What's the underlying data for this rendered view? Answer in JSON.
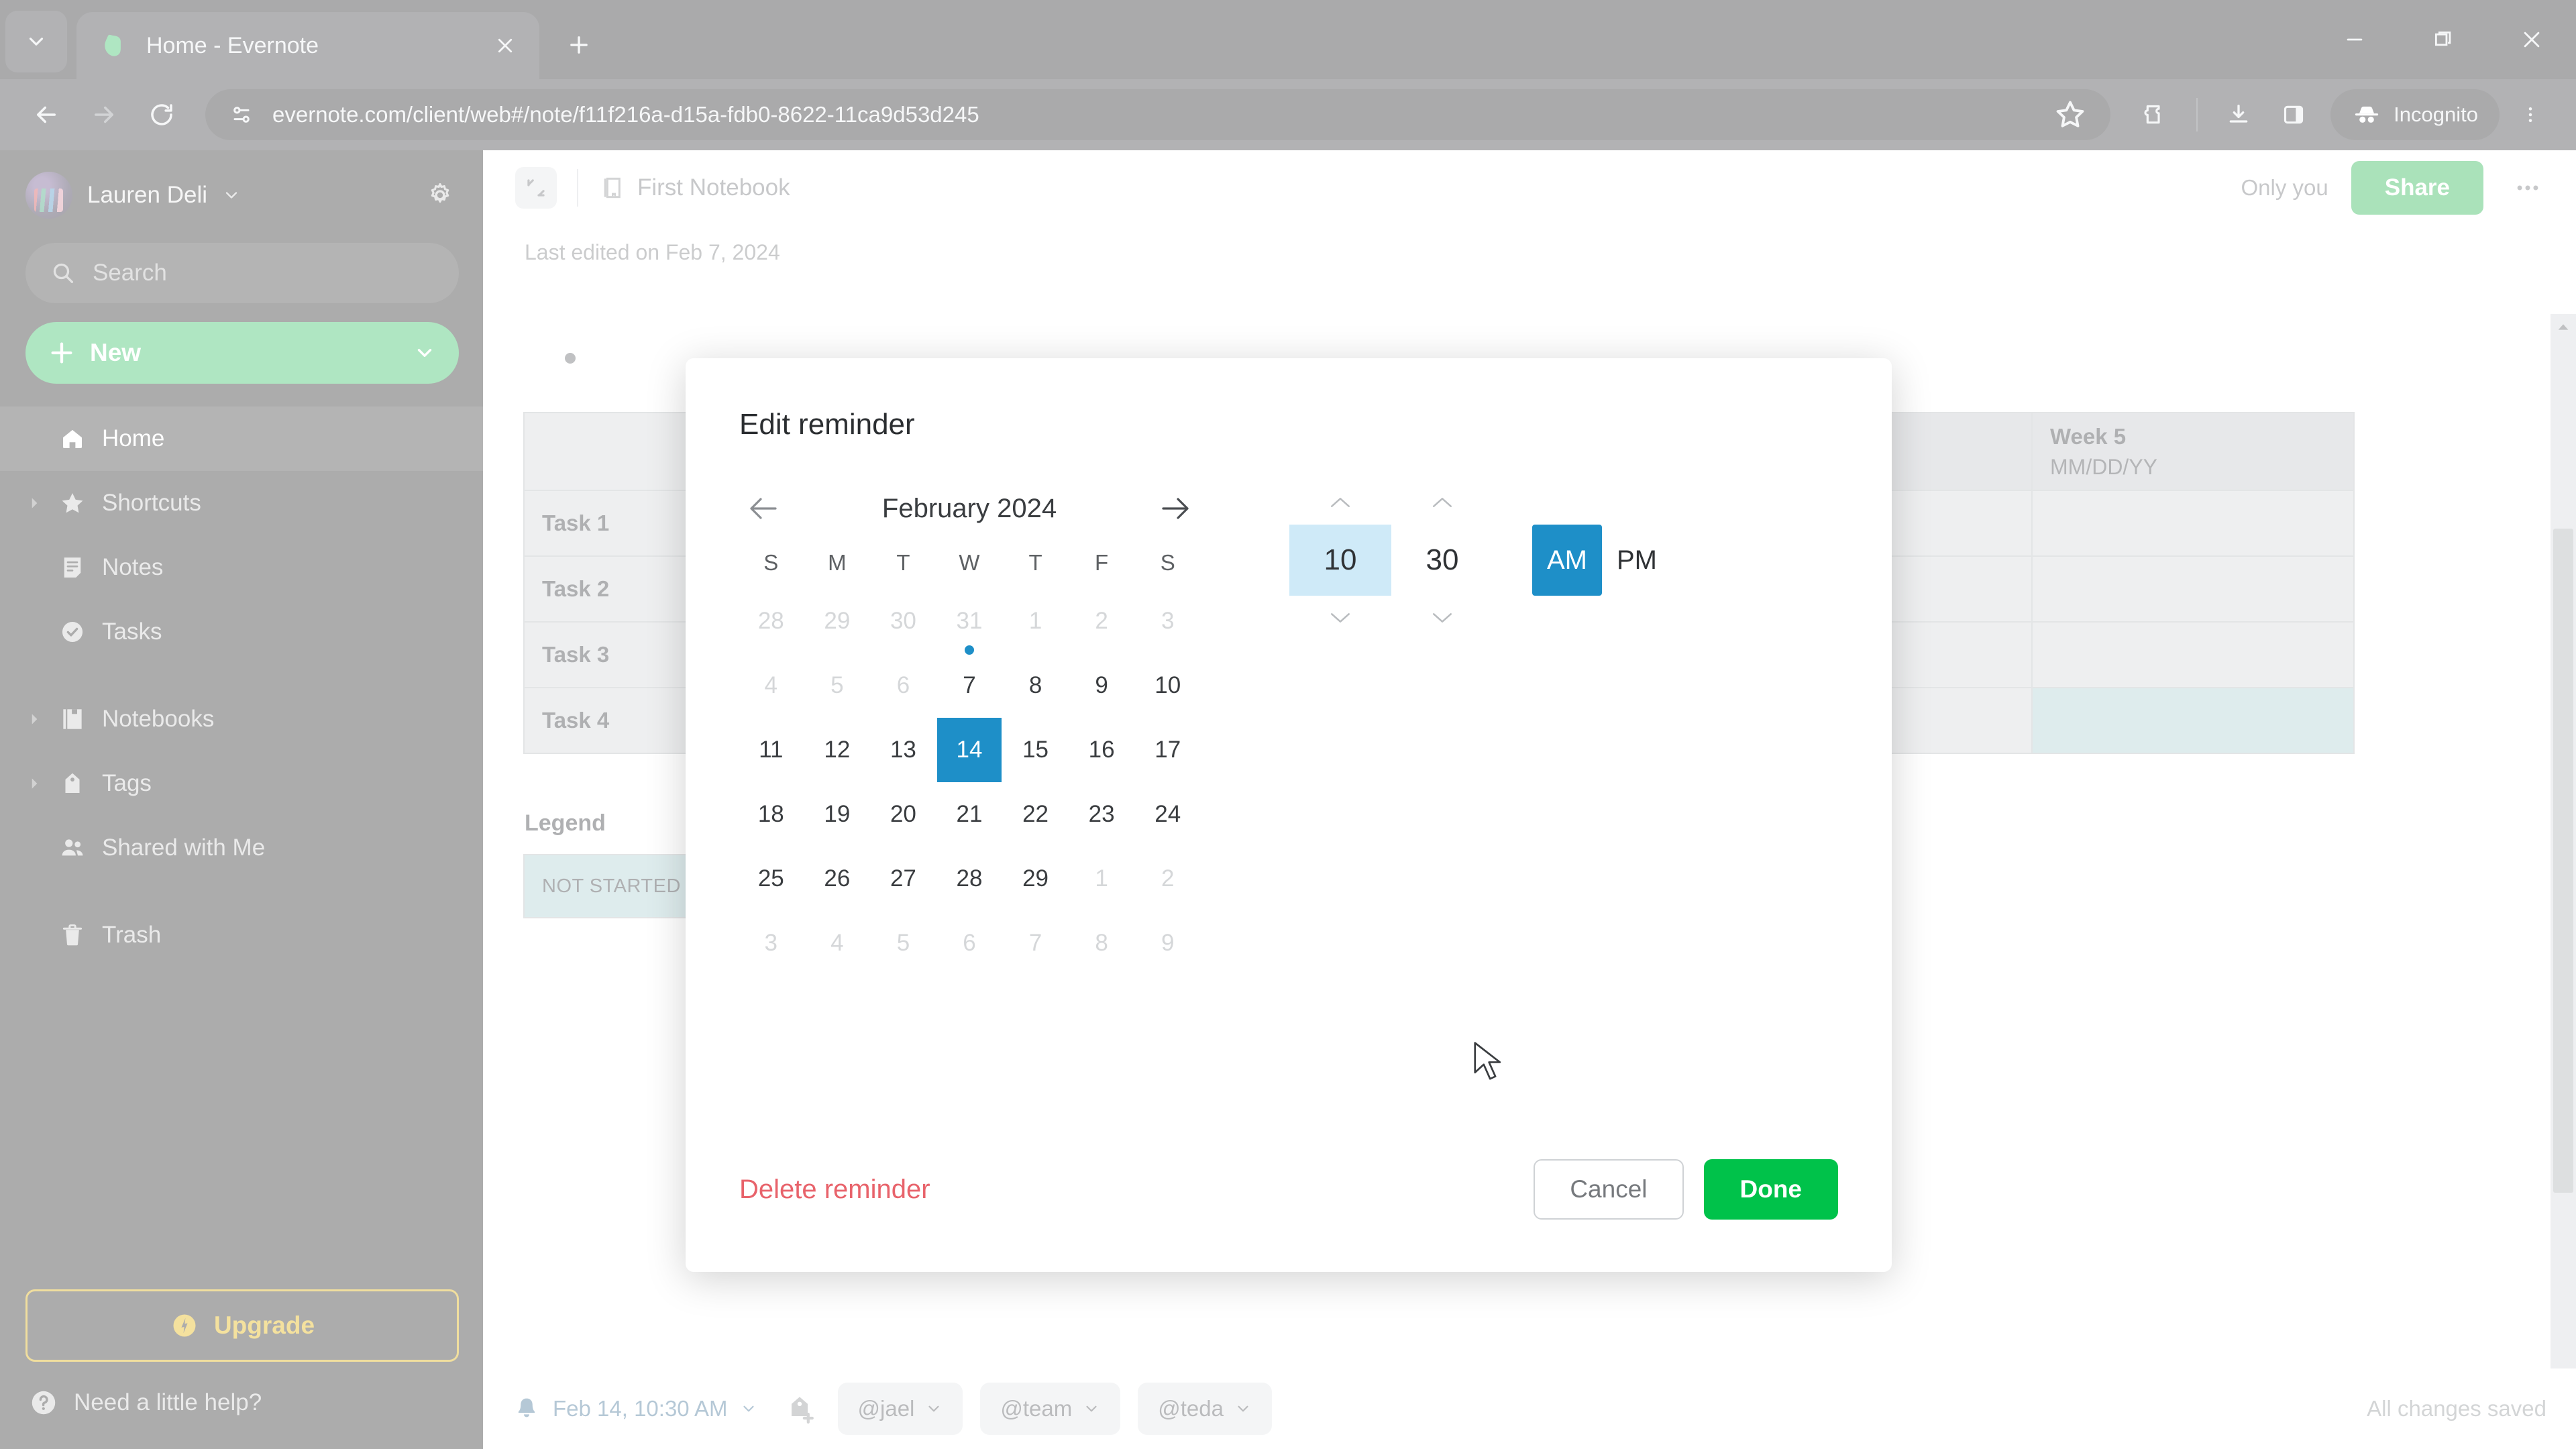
{
  "browser": {
    "tab": {
      "title": "Home - Evernote",
      "favicon": "evernote-elephant-icon"
    },
    "tab_list_icon": "chevron-down-icon",
    "new_tab_icon": "plus-icon",
    "close_tab_icon": "close-icon",
    "nav": {
      "back": "back-arrow-icon",
      "forward": "forward-arrow-icon",
      "reload": "reload-icon"
    },
    "omnibox": {
      "site_info_icon": "page-settings-icon",
      "url": "evernote.com/client/web#/note/f11f216a-d15a-fdb0-8622-11ca9d53d245",
      "bookmark_icon": "star-icon"
    },
    "toolbar_icons": [
      "extensions-icon",
      "downloads-icon",
      "side-panel-icon"
    ],
    "incognito": {
      "label": "Incognito",
      "icon": "incognito-hat-icon"
    },
    "menu_icon": "three-dot-menu-icon",
    "window_controls": {
      "minimize": "minimize-icon",
      "maximize": "maximize-icon",
      "close": "window-close-icon"
    }
  },
  "sidebar": {
    "user": {
      "name": "Lauren Deli",
      "chevron": "chevron-down-icon",
      "avatar": "user-avatar"
    },
    "settings_icon": "gear-icon",
    "search": {
      "placeholder": "Search",
      "icon": "search-icon"
    },
    "new_button": {
      "label": "New",
      "plus_icon": "plus-icon",
      "chevron": "chevron-down-icon",
      "color": "#2dbe60"
    },
    "items": [
      {
        "label": "Home",
        "icon": "home-icon",
        "active": true,
        "expandable": false
      },
      {
        "label": "Shortcuts",
        "icon": "star-icon",
        "active": false,
        "expandable": true
      },
      {
        "label": "Notes",
        "icon": "note-icon",
        "active": false,
        "expandable": false
      },
      {
        "label": "Tasks",
        "icon": "check-circle-icon",
        "active": false,
        "expandable": false
      },
      {
        "label": "Notebooks",
        "icon": "notebook-icon",
        "active": false,
        "expandable": true
      },
      {
        "label": "Tags",
        "icon": "tag-icon",
        "active": false,
        "expandable": true
      },
      {
        "label": "Shared with Me",
        "icon": "people-icon",
        "active": false,
        "expandable": false
      },
      {
        "label": "Trash",
        "icon": "trash-icon",
        "active": false,
        "expandable": false
      }
    ],
    "upgrade": {
      "label": "Upgrade",
      "icon": "bolt-icon",
      "color": "#e3b100"
    },
    "help": {
      "label": "Need a little help?",
      "icon": "question-circle-icon"
    }
  },
  "note": {
    "collapse_icon": "collapse-sidebar-icon",
    "notebook": {
      "label": "First Notebook",
      "icon": "notebook-icon"
    },
    "sharing_status": "Only you",
    "share_label": "Share",
    "more_icon": "three-dot-menu-icon",
    "last_edited": "Last edited on Feb 7, 2024",
    "table": {
      "row_labels": [
        "Task 1",
        "Task 2",
        "Task 3",
        "Task 4"
      ],
      "week_column": {
        "header": "Week 5",
        "subheader": "MM/DD/YY"
      }
    },
    "legend": {
      "title": "Legend",
      "status": "NOT STARTED",
      "status_color": "#a9cdd0"
    }
  },
  "bottom_bar": {
    "reminder": {
      "text": "Feb 14, 10:30 AM",
      "bell_icon": "bell-icon",
      "chevron": "chevron-down-icon"
    },
    "add_tag_icon": "add-tag-icon",
    "tags": [
      {
        "label": "@jael",
        "chevron": "chevron-down-icon"
      },
      {
        "label": "@team",
        "chevron": "chevron-down-icon"
      },
      {
        "label": "@teda",
        "chevron": "chevron-down-icon"
      }
    ],
    "save_status": "All changes saved"
  },
  "modal": {
    "title": "Edit reminder",
    "calendar": {
      "month_label": "February 2024",
      "prev_icon": "left-arrow-icon",
      "next_icon": "right-arrow-icon",
      "day_headers": [
        "S",
        "M",
        "T",
        "W",
        "T",
        "F",
        "S"
      ],
      "weeks": [
        [
          {
            "d": "28",
            "muted": true
          },
          {
            "d": "29",
            "muted": true
          },
          {
            "d": "30",
            "muted": true
          },
          {
            "d": "31",
            "muted": true
          },
          {
            "d": "1",
            "muted": true
          },
          {
            "d": "2",
            "muted": true
          },
          {
            "d": "3",
            "muted": true
          }
        ],
        [
          {
            "d": "4",
            "muted": true
          },
          {
            "d": "5",
            "muted": true
          },
          {
            "d": "6",
            "muted": true
          },
          {
            "d": "7",
            "muted": false,
            "today": true
          },
          {
            "d": "8",
            "muted": false
          },
          {
            "d": "9",
            "muted": false
          },
          {
            "d": "10",
            "muted": false
          }
        ],
        [
          {
            "d": "11"
          },
          {
            "d": "12"
          },
          {
            "d": "13"
          },
          {
            "d": "14",
            "selected": true
          },
          {
            "d": "15"
          },
          {
            "d": "16"
          },
          {
            "d": "17"
          }
        ],
        [
          {
            "d": "18"
          },
          {
            "d": "19"
          },
          {
            "d": "20"
          },
          {
            "d": "21"
          },
          {
            "d": "22"
          },
          {
            "d": "23"
          },
          {
            "d": "24"
          }
        ],
        [
          {
            "d": "25"
          },
          {
            "d": "26"
          },
          {
            "d": "27"
          },
          {
            "d": "28"
          },
          {
            "d": "29"
          },
          {
            "d": "1",
            "muted": true
          },
          {
            "d": "2",
            "muted": true
          }
        ],
        [
          {
            "d": "3",
            "muted": true
          },
          {
            "d": "4",
            "muted": true
          },
          {
            "d": "5",
            "muted": true
          },
          {
            "d": "6",
            "muted": true
          },
          {
            "d": "7",
            "muted": true
          },
          {
            "d": "8",
            "muted": true
          },
          {
            "d": "9",
            "muted": true
          }
        ]
      ],
      "selected_color": "#1e8fc8"
    },
    "time": {
      "hour": "10",
      "minute": "30",
      "hour_selected": true,
      "am_label": "AM",
      "pm_label": "PM",
      "meridiem": "AM",
      "up_icon": "chevron-up-icon",
      "down_icon": "chevron-down-icon"
    },
    "delete_label": "Delete reminder",
    "cancel_label": "Cancel",
    "done_label": "Done",
    "colors": {
      "delete": "#e8636b",
      "done": "#00c24a",
      "accent": "#1e8fc8"
    }
  }
}
